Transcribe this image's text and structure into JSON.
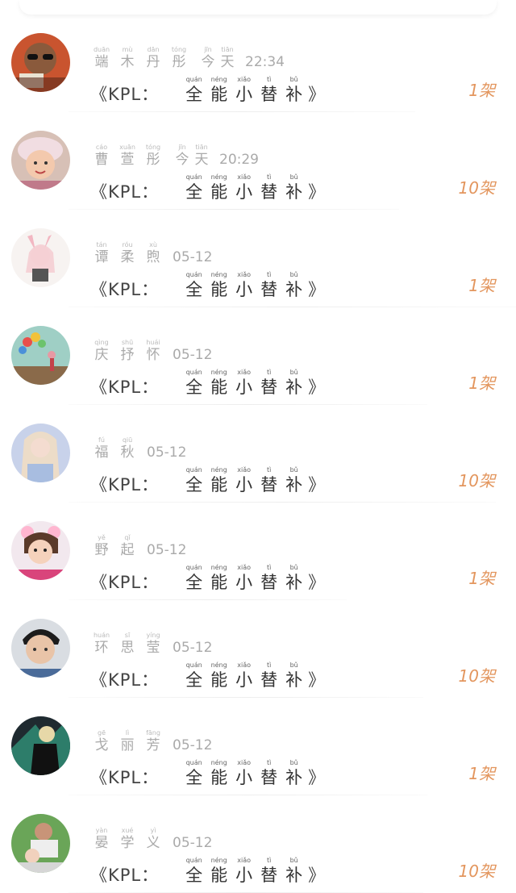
{
  "title_prefix": "《KPL：",
  "title_chars": [
    {
      "py": "quán",
      "hz": "全"
    },
    {
      "py": "néng",
      "hz": "能"
    },
    {
      "py": "xiǎo",
      "hz": "小"
    },
    {
      "py": "tì",
      "hz": "替"
    },
    {
      "py": "bǔ",
      "hz": "补"
    }
  ],
  "title_close": "》",
  "accent_color": "#e3965e",
  "rows": [
    {
      "name": [
        {
          "py": "duān",
          "hz": "端"
        },
        {
          "py": "mù",
          "hz": "木"
        },
        {
          "py": "dān",
          "hz": "丹"
        },
        {
          "py": "tóng",
          "hz": "彤"
        }
      ],
      "time_parts": [
        {
          "py": "jīn",
          "hz": "今"
        },
        {
          "py": "tiān",
          "hz": "天"
        }
      ],
      "time": "22:34",
      "count": "1架",
      "avatar": "avatar-sunglasses"
    },
    {
      "name": [
        {
          "py": "cáo",
          "hz": "曹"
        },
        {
          "py": "xuān",
          "hz": "萱"
        },
        {
          "py": "tóng",
          "hz": "彤"
        }
      ],
      "time_parts": [
        {
          "py": "jīn",
          "hz": "今"
        },
        {
          "py": "tiān",
          "hz": "天"
        }
      ],
      "time": "20:29",
      "count": "10架",
      "avatar": "avatar-baby-hat"
    },
    {
      "name": [
        {
          "py": "tán",
          "hz": "谭"
        },
        {
          "py": "róu",
          "hz": "柔"
        },
        {
          "py": "xù",
          "hz": "煦"
        }
      ],
      "time_parts": [],
      "time": "05-12",
      "count": "1架",
      "avatar": "avatar-anime-girl"
    },
    {
      "name": [
        {
          "py": "qìng",
          "hz": "庆"
        },
        {
          "py": "shū",
          "hz": "抒"
        },
        {
          "py": "huái",
          "hz": "怀"
        }
      ],
      "time_parts": [],
      "time": "05-12",
      "count": "1架",
      "avatar": "avatar-balloons"
    },
    {
      "name": [
        {
          "py": "fú",
          "hz": "福"
        },
        {
          "py": "qiū",
          "hz": "秋"
        }
      ],
      "time_parts": [],
      "time": "05-12",
      "count": "10架",
      "avatar": "avatar-blonde"
    },
    {
      "name": [
        {
          "py": "yě",
          "hz": "野"
        },
        {
          "py": "qǐ",
          "hz": "起"
        }
      ],
      "time_parts": [],
      "time": "05-12",
      "count": "1架",
      "avatar": "avatar-child-filter"
    },
    {
      "name": [
        {
          "py": "huán",
          "hz": "环"
        },
        {
          "py": "sī",
          "hz": "思"
        },
        {
          "py": "yíng",
          "hz": "莹"
        }
      ],
      "time_parts": [],
      "time": "05-12",
      "count": "10架",
      "avatar": "avatar-boy"
    },
    {
      "name": [
        {
          "py": "gē",
          "hz": "戈"
        },
        {
          "py": "lì",
          "hz": "丽"
        },
        {
          "py": "fāng",
          "hz": "芳"
        }
      ],
      "time_parts": [],
      "time": "05-12",
      "count": "1架",
      "avatar": "avatar-anime-dark"
    },
    {
      "name": [
        {
          "py": "yàn",
          "hz": "晏"
        },
        {
          "py": "xué",
          "hz": "学"
        },
        {
          "py": "yì",
          "hz": "义"
        }
      ],
      "time_parts": [],
      "time": "05-12",
      "count": "10架",
      "avatar": "avatar-family"
    }
  ]
}
